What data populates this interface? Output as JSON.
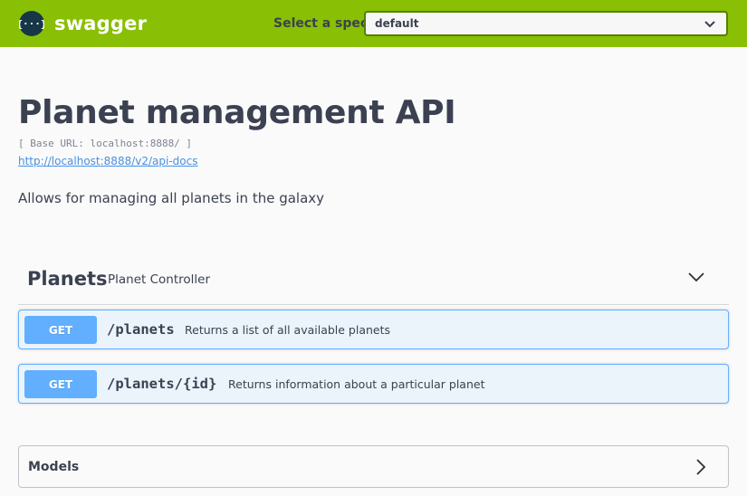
{
  "topbar": {
    "logo_text": "swagger",
    "logo_icon": "swagger-braces-icon",
    "spec_label": "Select a spec",
    "spec_selected": "default",
    "background_color": "#89bf04"
  },
  "info": {
    "title": "Planet management API",
    "base_url": "[ Base URL: localhost:8888/ ]",
    "docs_link": "http://localhost:8888/v2/api-docs",
    "description": "Allows for managing all planets in the galaxy"
  },
  "tag": {
    "name": "Planets",
    "description": "Planet Controller",
    "icon": "chevron-down-icon"
  },
  "operations": [
    {
      "method": "GET",
      "path": "/planets",
      "summary": "Returns a list of all available planets"
    },
    {
      "method": "GET",
      "path": "/planets/{id}",
      "summary": "Returns information about a particular planet"
    }
  ],
  "models": {
    "label": "Models",
    "icon": "chevron-right-icon"
  },
  "colors": {
    "get_method": "#61affe",
    "get_background": "#ebf3fb",
    "text": "#3b4151",
    "link": "#4990e2"
  }
}
